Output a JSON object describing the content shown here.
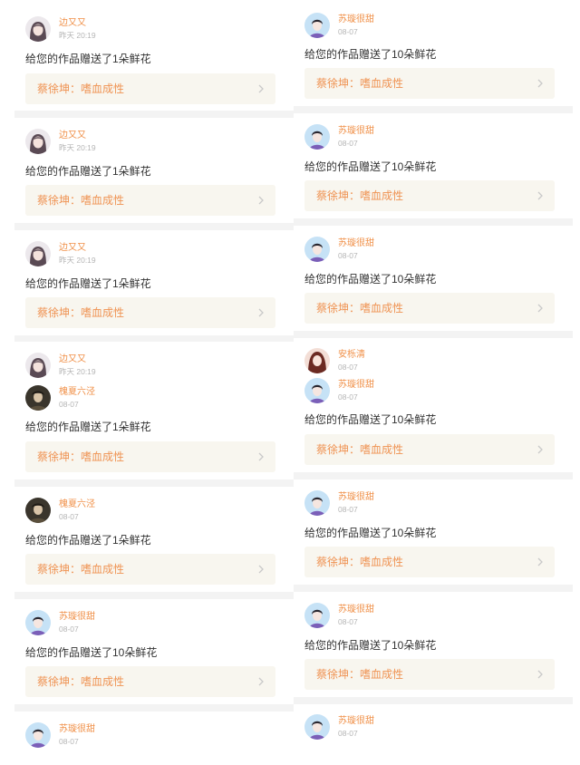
{
  "left_column": [
    {
      "users": [
        {
          "name": "边又又",
          "time": "昨天 20:19",
          "avatar": "avatar-girl"
        }
      ],
      "message": "给您的作品赠送了1朵鲜花",
      "work_title": "蔡徐坤：嗜血成性"
    },
    {
      "users": [
        {
          "name": "边又又",
          "time": "昨天 20:19",
          "avatar": "avatar-girl"
        }
      ],
      "message": "给您的作品赠送了1朵鲜花",
      "work_title": "蔡徐坤：嗜血成性"
    },
    {
      "users": [
        {
          "name": "边又又",
          "time": "昨天 20:19",
          "avatar": "avatar-girl"
        }
      ],
      "message": "给您的作品赠送了1朵鲜花",
      "work_title": "蔡徐坤：嗜血成性"
    },
    {
      "users": [
        {
          "name": "边又又",
          "time": "昨天 20:19",
          "avatar": "avatar-girl"
        },
        {
          "name": "槐夏六泾",
          "time": "08-07",
          "avatar": "avatar-dark"
        }
      ],
      "message": "给您的作品赠送了1朵鲜花",
      "work_title": "蔡徐坤：嗜血成性"
    },
    {
      "users": [
        {
          "name": "槐夏六泾",
          "time": "08-07",
          "avatar": "avatar-dark"
        }
      ],
      "message": "给您的作品赠送了1朵鲜花",
      "work_title": "蔡徐坤：嗜血成性"
    },
    {
      "users": [
        {
          "name": "苏璇很甜",
          "time": "08-07",
          "avatar": "avatar-boy"
        }
      ],
      "message": "给您的作品赠送了10朵鲜花",
      "work_title": "蔡徐坤：嗜血成性"
    },
    {
      "users": [
        {
          "name": "苏璇很甜",
          "time": "08-07",
          "avatar": "avatar-boy"
        }
      ]
    }
  ],
  "right_column": [
    {
      "users": [
        {
          "name": "苏璇很甜",
          "time": "08-07",
          "avatar": "avatar-boy"
        }
      ],
      "message": "给您的作品赠送了10朵鲜花",
      "work_title": "蔡徐坤：嗜血成性"
    },
    {
      "users": [
        {
          "name": "苏璇很甜",
          "time": "08-07",
          "avatar": "avatar-boy"
        }
      ],
      "message": "给您的作品赠送了10朵鲜花",
      "work_title": "蔡徐坤：嗜血成性"
    },
    {
      "users": [
        {
          "name": "苏璇很甜",
          "time": "08-07",
          "avatar": "avatar-boy"
        }
      ],
      "message": "给您的作品赠送了10朵鲜花",
      "work_title": "蔡徐坤：嗜血成性"
    },
    {
      "users": [
        {
          "name": "安栎清",
          "time": "08-07",
          "avatar": "avatar-redhair"
        },
        {
          "name": "苏璇很甜",
          "time": "08-07",
          "avatar": "avatar-boy"
        }
      ],
      "message": "给您的作品赠送了10朵鲜花",
      "work_title": "蔡徐坤：嗜血成性"
    },
    {
      "users": [
        {
          "name": "苏璇很甜",
          "time": "08-07",
          "avatar": "avatar-boy"
        }
      ],
      "message": "给您的作品赠送了10朵鲜花",
      "work_title": "蔡徐坤：嗜血成性"
    },
    {
      "users": [
        {
          "name": "苏璇很甜",
          "time": "08-07",
          "avatar": "avatar-boy"
        }
      ],
      "message": "给您的作品赠送了10朵鲜花",
      "work_title": "蔡徐坤：嗜血成性"
    },
    {
      "users": [
        {
          "name": "苏璇很甜",
          "time": "08-07",
          "avatar": "avatar-boy"
        }
      ]
    }
  ],
  "icons": {
    "card_arrow": "chevron-right-icon"
  },
  "colors": {
    "name": "#f0914a",
    "work_title": "#ef9353",
    "work_bg": "#f8f6ef",
    "separator": "#f3f3f3",
    "message": "#333333",
    "time": "#b5b5b5"
  }
}
